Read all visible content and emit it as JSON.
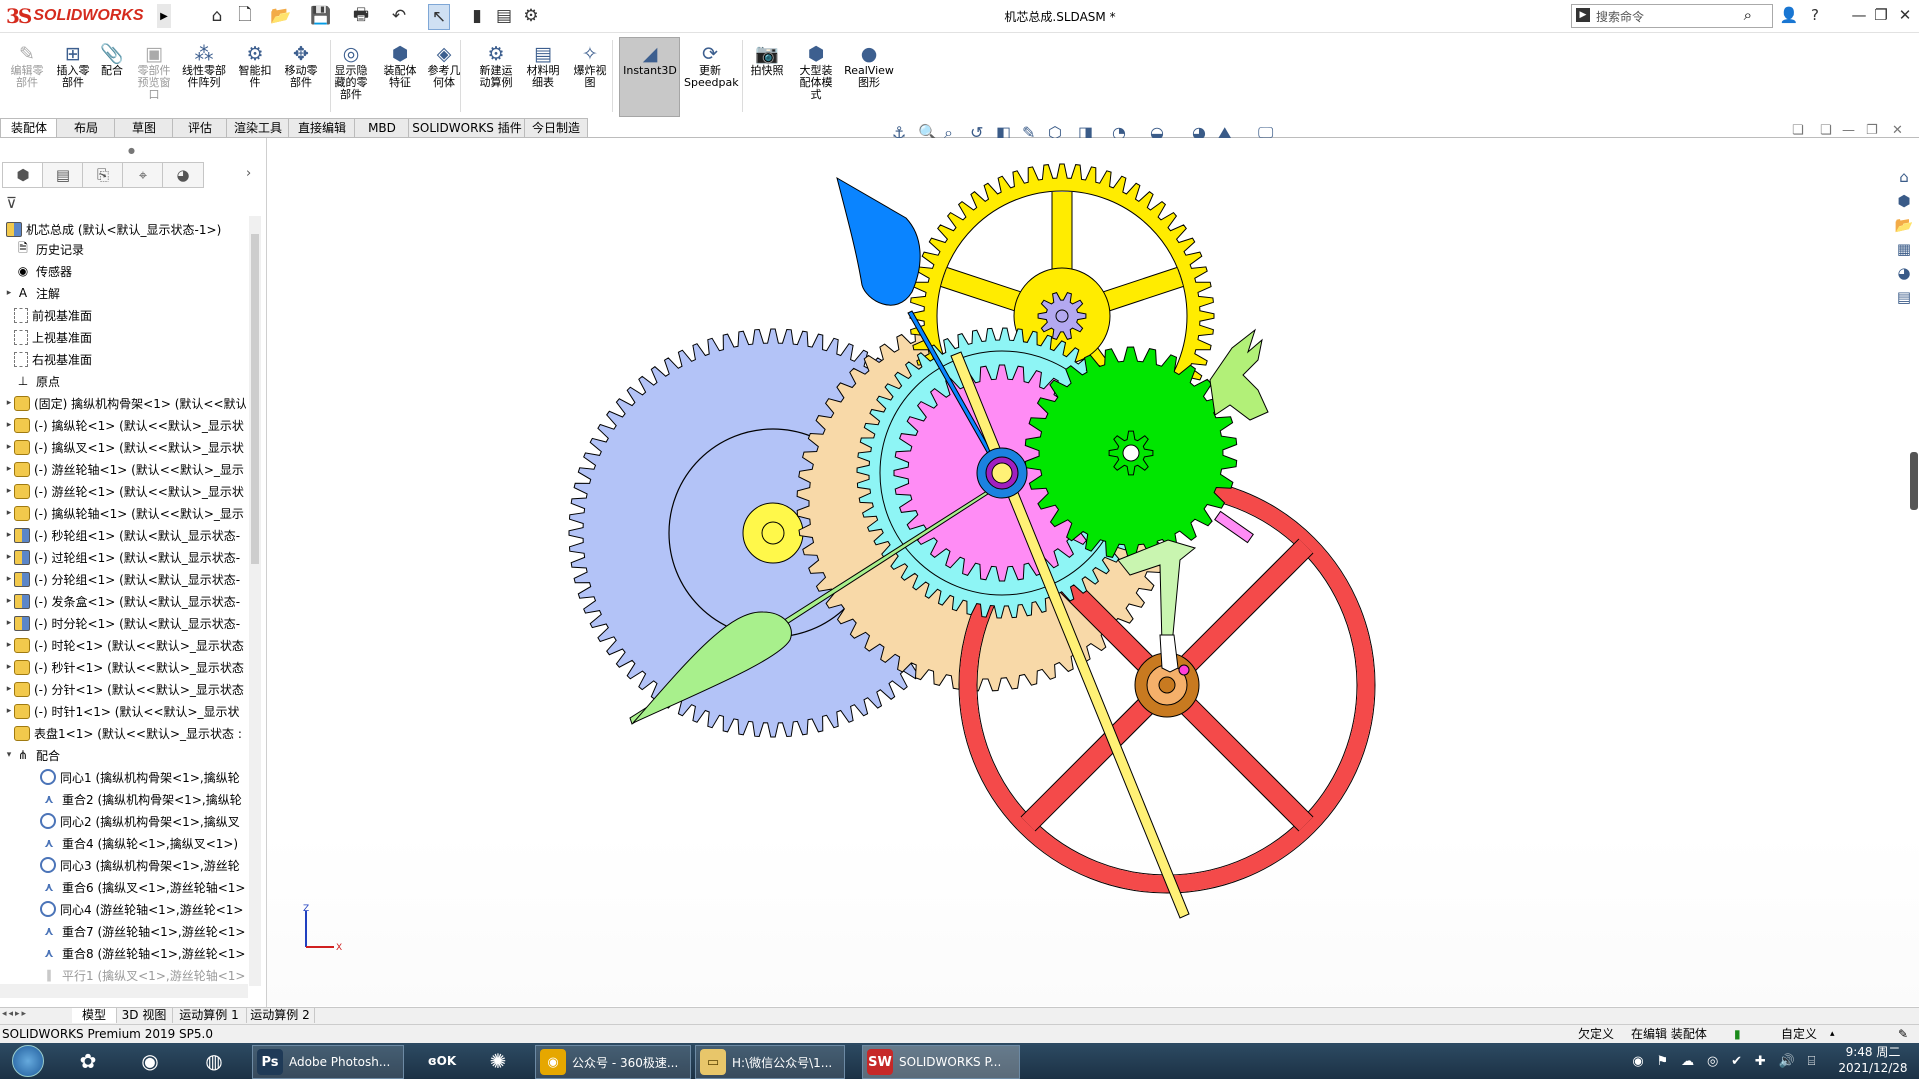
{
  "app": {
    "logo_ds": "3S",
    "logo_text": "SOLIDWORKS",
    "doc_title": "机芯总成.SLDASM *"
  },
  "search": {
    "placeholder": "搜索命令"
  },
  "toolbar": [
    {
      "label": "编辑零\n部件",
      "disabled": true,
      "icon": "edit-component-icon",
      "glyph": "✎"
    },
    {
      "label": "插入零\n部件",
      "disabled": false,
      "icon": "insert-component-icon",
      "glyph": "⊞"
    },
    {
      "label": "配合",
      "disabled": false,
      "icon": "mate-icon",
      "glyph": "📎"
    },
    {
      "label": "零部件\n预览窗\n口",
      "disabled": true,
      "icon": "component-preview-icon",
      "glyph": "▣"
    },
    {
      "label": "线性零部\n件阵列",
      "disabled": false,
      "icon": "linear-pattern-icon",
      "glyph": "⁂"
    },
    {
      "label": "智能扣\n件",
      "disabled": false,
      "icon": "smart-fastener-icon",
      "glyph": "⚙"
    },
    {
      "label": "移动零\n部件",
      "disabled": false,
      "icon": "move-component-icon",
      "glyph": "✥"
    },
    {
      "label": "显示隐\n藏的零\n部件",
      "disabled": false,
      "icon": "show-hidden-icon",
      "glyph": "◎"
    },
    {
      "label": "装配体\n特征",
      "disabled": false,
      "icon": "assembly-feature-icon",
      "glyph": "⬢"
    },
    {
      "label": "参考几\n何体",
      "disabled": false,
      "icon": "reference-geometry-icon",
      "glyph": "◈"
    },
    {
      "label": "新建运\n动算例",
      "disabled": false,
      "icon": "motion-study-icon",
      "glyph": "⚙"
    },
    {
      "label": "材料明\n细表",
      "disabled": false,
      "icon": "bom-icon",
      "glyph": "▤"
    },
    {
      "label": "爆炸视\n图",
      "disabled": false,
      "icon": "exploded-view-icon",
      "glyph": "✧"
    },
    {
      "label": "Instant3D",
      "disabled": false,
      "icon": "instant3d-icon",
      "glyph": "◢"
    },
    {
      "label": "更新\nSpeedpak",
      "disabled": false,
      "icon": "speedpak-icon",
      "glyph": "⟳"
    },
    {
      "label": "拍快照",
      "disabled": false,
      "icon": "snapshot-icon",
      "glyph": "📷"
    },
    {
      "label": "大型装\n配体模\n式",
      "disabled": false,
      "icon": "large-assembly-icon",
      "glyph": "⬢"
    },
    {
      "label": "RealView\n图形",
      "disabled": false,
      "icon": "realview-icon",
      "glyph": "●"
    }
  ],
  "tabs": [
    "装配体",
    "布局",
    "草图",
    "评估",
    "渲染工具",
    "直接编辑",
    "MBD",
    "SOLIDWORKS 插件",
    "今日制造"
  ],
  "tree": {
    "root": "机芯总成 (默认<默认_显示状态-1>)",
    "items": [
      {
        "label": "历史记录",
        "icon": "history-icon",
        "exp": ""
      },
      {
        "label": "传感器",
        "icon": "sensor-icon",
        "exp": ""
      },
      {
        "label": "注解",
        "icon": "annotation-icon",
        "exp": "▸"
      },
      {
        "label": "前视基准面",
        "icon": "plane-icon",
        "exp": ""
      },
      {
        "label": "上视基准面",
        "icon": "plane-icon",
        "exp": ""
      },
      {
        "label": "右视基准面",
        "icon": "plane-icon",
        "exp": ""
      },
      {
        "label": "原点",
        "icon": "origin-icon",
        "exp": ""
      },
      {
        "label": "(固定) 擒纵机构骨架<1> (默认<<默认",
        "icon": "part-icon",
        "exp": "▸"
      },
      {
        "label": "(-) 擒纵轮<1> (默认<<默认>_显示状",
        "icon": "part-icon",
        "exp": "▸"
      },
      {
        "label": "(-) 擒纵叉<1> (默认<<默认>_显示状",
        "icon": "part-icon",
        "exp": "▸"
      },
      {
        "label": "(-) 游丝轮轴<1> (默认<<默认>_显示",
        "icon": "part-icon",
        "exp": "▸"
      },
      {
        "label": "(-) 游丝轮<1> (默认<<默认>_显示状",
        "icon": "part-icon",
        "exp": "▸"
      },
      {
        "label": "(-) 擒纵轮轴<1> (默认<<默认>_显示",
        "icon": "part-icon",
        "exp": "▸"
      },
      {
        "label": "(-) 秒轮组<1> (默认<默认_显示状态-",
        "icon": "subassembly-icon",
        "exp": "▸"
      },
      {
        "label": "(-) 过轮组<1> (默认<默认_显示状态-",
        "icon": "subassembly-icon",
        "exp": "▸"
      },
      {
        "label": "(-) 分轮组<1> (默认<默认_显示状态-",
        "icon": "subassembly-icon",
        "exp": "▸"
      },
      {
        "label": "(-) 发条盒<1> (默认<默认_显示状态-",
        "icon": "subassembly-icon",
        "exp": "▸"
      },
      {
        "label": "(-) 时分轮<1> (默认<默认_显示状态-",
        "icon": "subassembly-icon",
        "exp": "▸"
      },
      {
        "label": "(-) 时轮<1> (默认<<默认>_显示状态",
        "icon": "part-icon",
        "exp": "▸"
      },
      {
        "label": "(-) 秒针<1> (默认<<默认>_显示状态",
        "icon": "part-icon",
        "exp": "▸"
      },
      {
        "label": "(-) 分针<1> (默认<<默认>_显示状态",
        "icon": "part-icon",
        "exp": "▸"
      },
      {
        "label": "(-) 时针1<1> (默认<<默认>_显示状",
        "icon": "part-icon",
        "exp": "▸"
      },
      {
        "label": "表盘1<1> (默认<<默认>_显示状态 :",
        "icon": "part-icon",
        "exp": ""
      },
      {
        "label": "配合",
        "icon": "mates-folder-icon",
        "exp": "▾"
      },
      {
        "label": "同心1 (擒纵机构骨架<1>,擒纵轮",
        "icon": "concentric-mate-icon",
        "exp": "",
        "indent": 1
      },
      {
        "label": "重合2 (擒纵机构骨架<1>,擒纵轮",
        "icon": "coincident-mate-icon",
        "exp": "",
        "indent": 1
      },
      {
        "label": "同心2 (擒纵机构骨架<1>,擒纵叉",
        "icon": "concentric-mate-icon",
        "exp": "",
        "indent": 1
      },
      {
        "label": "重合4 (擒纵轮<1>,擒纵叉<1>)",
        "icon": "coincident-mate-icon",
        "exp": "",
        "indent": 1
      },
      {
        "label": "同心3 (擒纵机构骨架<1>,游丝轮",
        "icon": "concentric-mate-icon",
        "exp": "",
        "indent": 1
      },
      {
        "label": "重合6 (擒纵叉<1>,游丝轮轴<1>",
        "icon": "coincident-mate-icon",
        "exp": "",
        "indent": 1
      },
      {
        "label": "同心4 (游丝轮轴<1>,游丝轮<1>",
        "icon": "concentric-mate-icon",
        "exp": "",
        "indent": 1
      },
      {
        "label": "重合7 (游丝轮轴<1>,游丝轮<1>",
        "icon": "coincident-mate-icon",
        "exp": "",
        "indent": 1
      },
      {
        "label": "重合8 (游丝轮轴<1>,游丝轮<1>",
        "icon": "coincident-mate-icon",
        "exp": "",
        "indent": 1
      },
      {
        "label": "平行1 (擒纵叉<1>,游丝轮轴<1>",
        "icon": "parallel-mate-icon",
        "exp": "",
        "indent": 1
      }
    ]
  },
  "bottom_tabs": [
    "模型",
    "3D 视图",
    "运动算例 1",
    "运动算例 2"
  ],
  "status": {
    "left": "SOLIDWORKS Premium 2019 SP5.0",
    "defined": "欠定义",
    "editing": "在编辑 装配体",
    "custom": "自定义"
  },
  "triad": {
    "z": "Z",
    "x": "X"
  },
  "taskbar": [
    {
      "label": "Adobe Photosh...",
      "tag": "Ps",
      "color": "#1f3a57"
    },
    {
      "label": "公众号 - 360极速...",
      "tag": "◉",
      "color": "#e6a700"
    },
    {
      "label": "H:\\微信公众号\\1...",
      "tag": "▭",
      "color": "#e8c66a"
    },
    {
      "label": "SOLIDWORKS P...",
      "tag": "SW",
      "color": "#c62828"
    }
  ],
  "clock": {
    "time": "9:48 周二",
    "date": "2021/12/28"
  },
  "colors": {
    "yellow": "#ffec00",
    "blue_gray": "#b3c3f7",
    "cyan": "#8ef5f5",
    "magenta": "#ff8cf5",
    "green": "#00e600",
    "red": "#f44a4a",
    "tan": "#f8d9a8",
    "bronze": "#c87a20"
  }
}
